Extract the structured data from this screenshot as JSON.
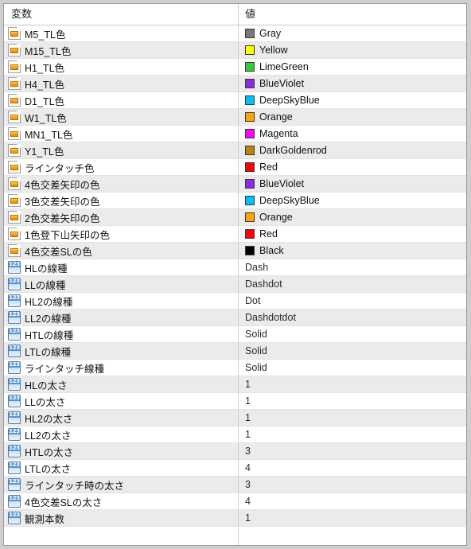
{
  "window": {
    "type": "property-grid",
    "columns": {
      "variable": "変数",
      "value": "値"
    }
  },
  "colors": {
    "gray": "#808080",
    "yellow": "#ffff00",
    "limegreen": "#32cd32",
    "blueviolet": "#8a2be2",
    "deepskyblue": "#00bfff",
    "orange": "#ffa500",
    "magenta": "#ff00ff",
    "darkgoldenrod": "#b8860b",
    "red": "#ff0000",
    "black": "#000000"
  },
  "rows": [
    {
      "icon": "color-icon",
      "name": "M5_TL色",
      "value": "Gray",
      "swatch": "#808080",
      "checkered": true
    },
    {
      "icon": "color-icon",
      "name": "M15_TL色",
      "value": "Yellow",
      "swatch": "#ffff00"
    },
    {
      "icon": "color-icon",
      "name": "H1_TL色",
      "value": "LimeGreen",
      "swatch": "#32cd32"
    },
    {
      "icon": "color-icon",
      "name": "H4_TL色",
      "value": "BlueViolet",
      "swatch": "#8a2be2"
    },
    {
      "icon": "color-icon",
      "name": "D1_TL色",
      "value": "DeepSkyBlue",
      "swatch": "#00bfff"
    },
    {
      "icon": "color-icon",
      "name": "W1_TL色",
      "value": "Orange",
      "swatch": "#ffa500"
    },
    {
      "icon": "color-icon",
      "name": "MN1_TL色",
      "value": "Magenta",
      "swatch": "#ff00ff"
    },
    {
      "icon": "color-icon",
      "name": "Y1_TL色",
      "value": "DarkGoldenrod",
      "swatch": "#b8860b"
    },
    {
      "icon": "color-icon",
      "name": "ラインタッチ色",
      "value": "Red",
      "swatch": "#ff0000"
    },
    {
      "icon": "color-icon",
      "name": "4色交差矢印の色",
      "value": "BlueViolet",
      "swatch": "#8a2be2"
    },
    {
      "icon": "color-icon",
      "name": "3色交差矢印の色",
      "value": "DeepSkyBlue",
      "swatch": "#00bfff"
    },
    {
      "icon": "color-icon",
      "name": "2色交差矢印の色",
      "value": "Orange",
      "swatch": "#ffa500"
    },
    {
      "icon": "color-icon",
      "name": "1色登下山矢印の色",
      "value": "Red",
      "swatch": "#ff0000"
    },
    {
      "icon": "color-icon",
      "name": "4色交差SLの色",
      "value": "Black",
      "swatch": "#000000"
    },
    {
      "icon": "numeric-icon",
      "name": "HLの線種",
      "value": "Dash"
    },
    {
      "icon": "numeric-icon",
      "name": "LLの線種",
      "value": "Dashdot"
    },
    {
      "icon": "numeric-icon",
      "name": "HL2の線種",
      "value": "Dot"
    },
    {
      "icon": "numeric-icon",
      "name": "LL2の線種",
      "value": "Dashdotdot"
    },
    {
      "icon": "numeric-icon",
      "name": "HTLの線種",
      "value": "Solid"
    },
    {
      "icon": "numeric-icon",
      "name": "LTLの線種",
      "value": "Solid"
    },
    {
      "icon": "numeric-icon",
      "name": "ラインタッチ線種",
      "value": "Solid"
    },
    {
      "icon": "numeric-icon",
      "name": "HLの太さ",
      "value": "1"
    },
    {
      "icon": "numeric-icon",
      "name": "LLの太さ",
      "value": "1"
    },
    {
      "icon": "numeric-icon",
      "name": "HL2の太さ",
      "value": "1"
    },
    {
      "icon": "numeric-icon",
      "name": "LL2の太さ",
      "value": "1"
    },
    {
      "icon": "numeric-icon",
      "name": "HTLの太さ",
      "value": "3"
    },
    {
      "icon": "numeric-icon",
      "name": "LTLの太さ",
      "value": "4"
    },
    {
      "icon": "numeric-icon",
      "name": "ラインタッチ時の太さ",
      "value": "3"
    },
    {
      "icon": "numeric-icon",
      "name": "4色交差SLの太さ",
      "value": "4"
    },
    {
      "icon": "numeric-icon",
      "name": "観測本数",
      "value": "1"
    }
  ],
  "icon_glyph": {
    "numeric": "123"
  }
}
